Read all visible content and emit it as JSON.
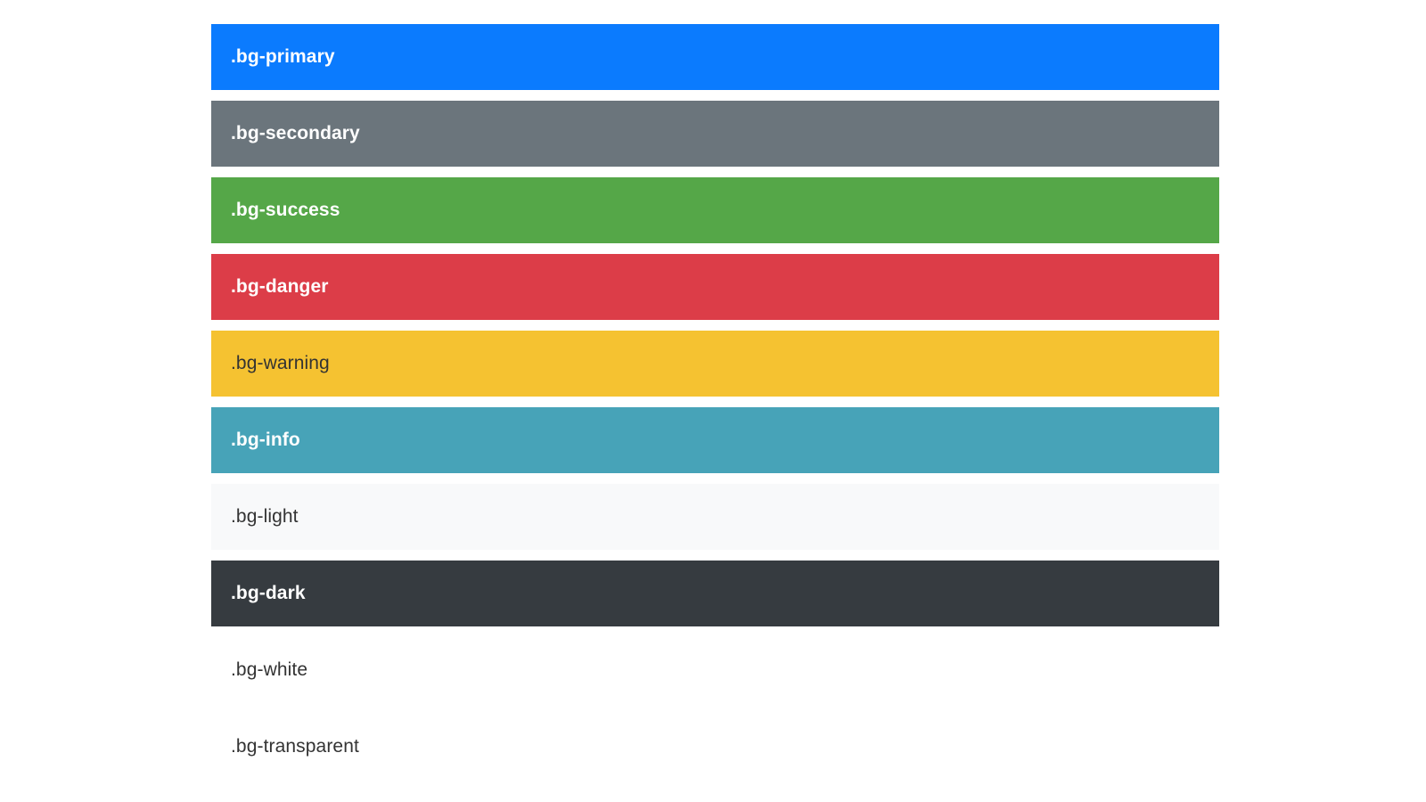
{
  "swatches": [
    {
      "label": ".bg-primary",
      "bg": "#0b7bfe",
      "color": "#ffffff",
      "bold": true
    },
    {
      "label": ".bg-secondary",
      "bg": "#6b757c",
      "color": "#ffffff",
      "bold": true
    },
    {
      "label": ".bg-success",
      "bg": "#55a748",
      "color": "#ffffff",
      "bold": true
    },
    {
      "label": ".bg-danger",
      "bg": "#dc3d48",
      "color": "#ffffff",
      "bold": true
    },
    {
      "label": ".bg-warning",
      "bg": "#f5c231",
      "color": "#333333",
      "bold": false
    },
    {
      "label": ".bg-info",
      "bg": "#47a3b8",
      "color": "#ffffff",
      "bold": true
    },
    {
      "label": ".bg-light",
      "bg": "#f8f9fa",
      "color": "#333333",
      "bold": false
    },
    {
      "label": ".bg-dark",
      "bg": "#363b40",
      "color": "#ffffff",
      "bold": true
    },
    {
      "label": ".bg-white",
      "bg": "#ffffff",
      "color": "#333333",
      "bold": false
    },
    {
      "label": ".bg-transparent",
      "bg": "transparent",
      "color": "#333333",
      "bold": false
    }
  ]
}
